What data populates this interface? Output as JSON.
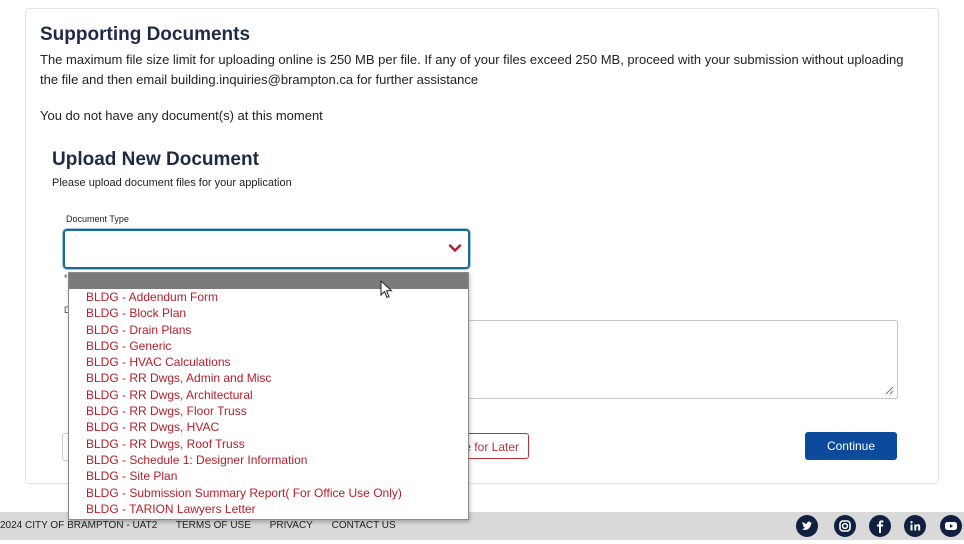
{
  "supporting": {
    "title": "Supporting Documents",
    "description": "The maximum file size limit for uploading online is 250 MB per file. If any of your files exceed 250 MB, proceed with your submission without uploading the file and then email building.inquiries@brampton.ca for further assistance",
    "no_docs": "You do not have any document(s) at this moment"
  },
  "upload": {
    "title": "Upload New Document",
    "subtitle": "Please upload document files for your application",
    "doc_type_label": "Document Type",
    "selected_value": "",
    "options": [
      "",
      "BLDG - Addendum Form",
      "BLDG - Block Plan",
      "BLDG - Drain Plans",
      "BLDG - Generic",
      "BLDG - HVAC Calculations",
      "BLDG - RR Dwgs, Admin and Misc",
      "BLDG - RR Dwgs, Architectural",
      "BLDG - RR Dwgs, Floor Truss",
      "BLDG - RR Dwgs, HVAC",
      "BLDG - RR Dwgs, Roof Truss",
      "BLDG - Schedule 1: Designer Information",
      "BLDG - Site Plan",
      "BLDG - Submission Summary Report( For Office Use Only)",
      "BLDG - TARION Lawyers Letter"
    ]
  },
  "buttons": {
    "save_later": "e for Later",
    "continue": "Continue"
  },
  "footer": {
    "copyright": "2024 CITY OF BRAMPTON - UAT2",
    "terms": "TERMS OF USE",
    "privacy": "PRIVACY",
    "contact": "CONTACT US",
    "social_icons": [
      "twitter-icon",
      "instagram-icon",
      "facebook-icon",
      "linkedin-icon",
      "youtube-icon"
    ]
  },
  "colors": {
    "accent": "#0c4a9c",
    "focus_border": "#1b6a8f",
    "option_text": "#b3202a"
  }
}
